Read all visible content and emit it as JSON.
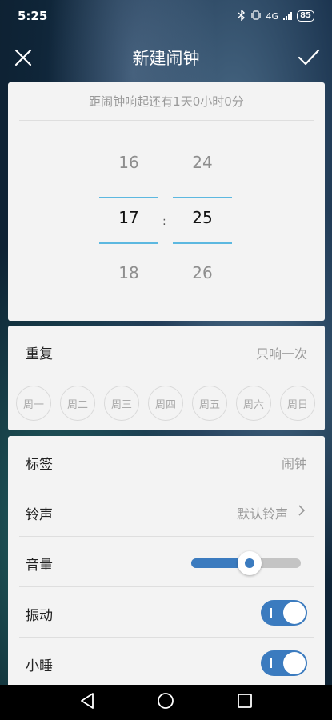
{
  "status": {
    "time": "5:25",
    "network": "4G",
    "battery": "85"
  },
  "header": {
    "title": "新建闹钟",
    "close_icon": "close-icon",
    "confirm_icon": "check-icon"
  },
  "picker": {
    "countdown": "距闹钟响起还有1天0小时0分",
    "hours": [
      "16",
      "17",
      "18"
    ],
    "minutes": [
      "24",
      "25",
      "26"
    ],
    "separator": ":"
  },
  "repeat": {
    "label": "重复",
    "value": "只响一次",
    "days": [
      "周一",
      "周二",
      "周三",
      "周四",
      "周五",
      "周六",
      "周日"
    ]
  },
  "settings": {
    "tag": {
      "label": "标签",
      "value": "闹钟"
    },
    "ringtone": {
      "label": "铃声",
      "value": "默认铃声"
    },
    "volume": {
      "label": "音量",
      "level": 0.53
    },
    "vibrate": {
      "label": "振动",
      "on": true
    },
    "snooze": {
      "label": "小睡",
      "on": true
    }
  },
  "colors": {
    "accent": "#3b7bbf",
    "wheel_line": "#5cb8e0"
  }
}
